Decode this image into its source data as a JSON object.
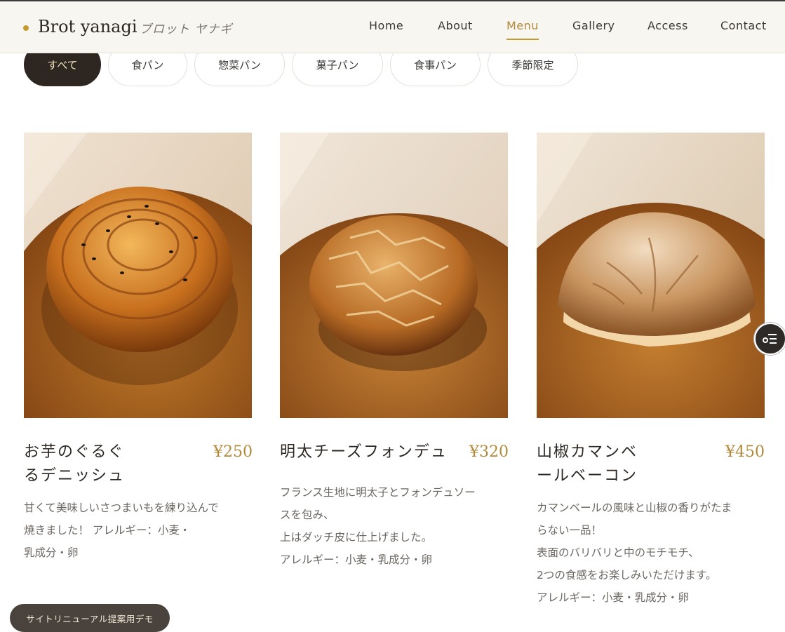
{
  "header": {
    "logo": "Brot yanagi",
    "logo_kana": "ブロット ヤナギ",
    "nav": [
      "Home",
      "About",
      "Menu",
      "Gallery",
      "Access",
      "Contact"
    ],
    "active_nav": "Menu"
  },
  "filters": {
    "items": [
      "すべて",
      "食パン",
      "惣菜パン",
      "菓子パン",
      "食事パン",
      "季節限定"
    ],
    "active": "すべて"
  },
  "products": [
    {
      "title_line1": "お芋のぐるぐ",
      "title_line2": "るデニッシュ",
      "price": "¥250",
      "desc": "甘くて美味しいさつまいもを練り込んで\n焼きました！ アレルギー：小麦・\n乳成分・卵",
      "image_icon": "danish-pastry-image"
    },
    {
      "title_line1": "明太チーズフォンデュ",
      "title_line2": "",
      "price": "¥320",
      "desc": "フランス生地に明太子とフォンデュソー\nスを包み、\n上はダッチ皮に仕上げました。\nアレルギー：小麦・乳成分・卵",
      "image_icon": "dutch-crust-bread-image"
    },
    {
      "title_line1": "山椒カマンベ",
      "title_line2": "ールベーコン",
      "price": "¥450",
      "desc": "カマンベールの風味と山椒の香りがたま\nらない一品！\n表面のバリバリと中のモチモチ、\n2つの食感をお楽しみいただけます。\nアレルギー：小麦・乳成分・卵",
      "image_icon": "country-bread-image"
    }
  ],
  "demo_badge": "サイトリニューアル提案用デモ",
  "side_button_icon": "filter-list-icon",
  "colors": {
    "accent": "#b08a3a",
    "dark": "#2e2620",
    "header_bg": "#f8f6f1"
  }
}
